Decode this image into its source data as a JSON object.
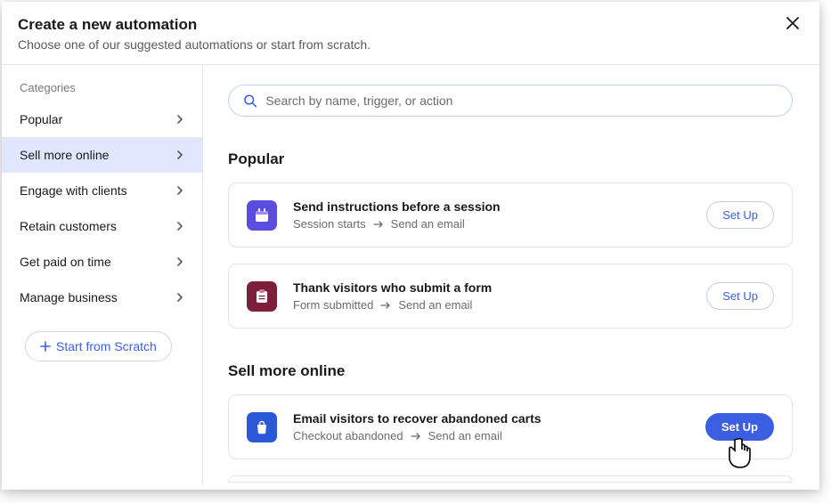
{
  "header": {
    "title": "Create a new automation",
    "subtitle": "Choose one of our suggested automations or start from scratch."
  },
  "sidebar": {
    "title": "Categories",
    "items": [
      {
        "label": "Popular",
        "active": false
      },
      {
        "label": "Sell more online",
        "active": true
      },
      {
        "label": "Engage with clients",
        "active": false
      },
      {
        "label": "Retain customers",
        "active": false
      },
      {
        "label": "Get paid on time",
        "active": false
      },
      {
        "label": "Manage business",
        "active": false
      }
    ],
    "scratch_btn": "Start from Scratch"
  },
  "search": {
    "placeholder": "Search by name, trigger, or action"
  },
  "sections": {
    "popular": {
      "title": "Popular",
      "cards": [
        {
          "title": "Send instructions before a session",
          "trigger": "Session starts",
          "action": "Send an email",
          "btn": "Set Up"
        },
        {
          "title": "Thank visitors who submit a form",
          "trigger": "Form submitted",
          "action": "Send an email",
          "btn": "Set Up"
        }
      ]
    },
    "sell_more": {
      "title": "Sell more online",
      "cards": [
        {
          "title": "Email visitors to recover abandoned carts",
          "trigger": "Checkout abandoned",
          "action": "Send an email",
          "btn": "Set Up"
        }
      ]
    }
  }
}
